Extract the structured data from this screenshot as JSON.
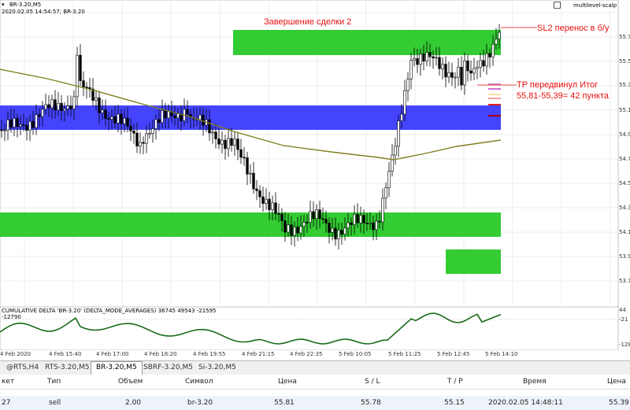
{
  "chart": {
    "symbol_label": "BR-3.20,M5",
    "timestamp": "2020.02.05 14:54:57; BR-3.20",
    "expert_label": "multilevel-scalp",
    "annotations": {
      "deal_close": "Завершение сделки 2",
      "sl_move": "SL2 перенос в б/у",
      "tp_line1": "TP передвинул Итог",
      "tp_line2": "55,81-55,39= 42 пункта"
    },
    "price_labels": [
      "55.7",
      "55.5",
      "55.3",
      "55.1",
      "54.9",
      "54.7",
      "54.5",
      "54.3",
      "54.1",
      "53.9",
      "53.7"
    ],
    "indicator_label": "CUMULATIVE DELTA 'BR-3.20' (DELTA_MODE_AVERAGES) 36745 49543 -21595",
    "indicator_value": "-12790",
    "indicator_axis": [
      "44",
      "-21",
      "-128"
    ],
    "time_labels": [
      "4 Feb 2020",
      "4 Feb 15:40",
      "4 Feb 17:00",
      "4 Feb 18:20",
      "4 Feb 19:55",
      "4 Feb 21:15",
      "4 Feb 22:35",
      "5 Feb 10:05",
      "5 Feb 11:25",
      "5 Feb 12:45",
      "5 Feb 14:10"
    ],
    "colors": {
      "bull_candle": "#000000",
      "zone_green": "#33cc33",
      "zone_blue": "#4444ff",
      "ma_line": "#808020",
      "indicator_line": "#1a6b1a",
      "annotation": "#e8100e"
    }
  },
  "tabs": [
    {
      "label": "@RTS,H4",
      "active": false
    },
    {
      "label": "RTS-3.20,M5",
      "active": false
    },
    {
      "label": "BR-3.20,M5",
      "active": true
    },
    {
      "label": "SBRF-3.20,M5",
      "active": false
    },
    {
      "label": "Si-3.20,M5",
      "active": false
    }
  ],
  "positions_table": {
    "headers": {
      "ticket": "кет",
      "type": "Тип",
      "volume": "Объем",
      "symbol": "Символ",
      "price": "Цена",
      "sl": "S / L",
      "tp": "T / P",
      "time": "Время",
      "price2": "Цена"
    },
    "row": {
      "ticket": "27",
      "type": "sell",
      "volume": "2.00",
      "symbol": "br-3.20",
      "price": "55.81",
      "sl": "55.78",
      "tp": "55.15",
      "time": "2020.02.05 14:48:11",
      "price2": "55.39"
    }
  }
}
